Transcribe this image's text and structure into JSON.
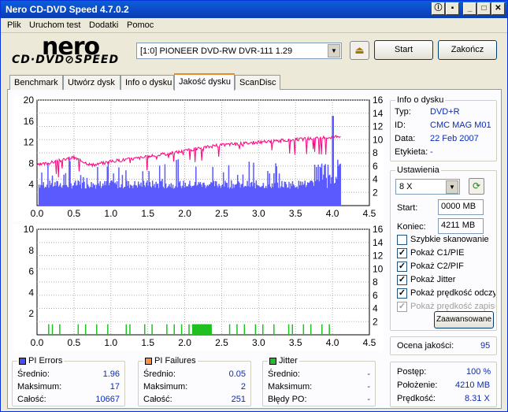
{
  "window": {
    "title": "Nero CD-DVD Speed 4.7.0.2"
  },
  "menu": [
    "Plik",
    "Uruchom test",
    "Dodatki",
    "Pomoc"
  ],
  "logo": {
    "brand": "nero",
    "subtitle": "CD·DVD⊘SPEED"
  },
  "drive": {
    "selected": "[1:0]   PIONEER DVD-RW  DVR-111 1.29"
  },
  "buttons": {
    "start": "Start",
    "end": "Zakończ",
    "advanced": "Zaawansowane"
  },
  "tabs": [
    "Benchmark",
    "Utwórz dysk",
    "Info o dysku",
    "Jakość dysku",
    "ScanDisc"
  ],
  "active_tab": "Jakość dysku",
  "disc_info": {
    "caption": "Info o dysku",
    "typ_label": "Typ:",
    "typ": "DVD+R",
    "id_label": "ID:",
    "id": "CMC MAG M01",
    "data_label": "Data:",
    "data": "22 Feb 2007",
    "etykieta_label": "Etykieta:",
    "etykieta": "-"
  },
  "settings": {
    "caption": "Ustawienia",
    "speed": "8 X",
    "start_label": "Start:",
    "start": "0000 MB",
    "end_label": "Koniec:",
    "end": "4211 MB",
    "checks": [
      {
        "label": "Szybkie skanowanie",
        "checked": false,
        "enabled": true
      },
      {
        "label": "Pokaż C1/PIE",
        "checked": true,
        "enabled": true
      },
      {
        "label": "Pokaż C2/PIF",
        "checked": true,
        "enabled": true
      },
      {
        "label": "Pokaż Jitter",
        "checked": true,
        "enabled": true
      },
      {
        "label": "Pokaż prędkość odczytu",
        "checked": true,
        "enabled": true
      },
      {
        "label": "Pokaż prędkość zapisu",
        "checked": true,
        "enabled": false
      }
    ]
  },
  "quality": {
    "label": "Ocena jakości:",
    "value": "95"
  },
  "progress": {
    "postep_label": "Postęp:",
    "postep": "100 %",
    "polozenie_label": "Położenie:",
    "polozenie": "4210 MB",
    "predkosc_label": "Prędkość:",
    "predkosc": "8.31 X"
  },
  "pi_errors": {
    "caption": "PI Errors",
    "color": "#4a4aff",
    "avg_label": "Średnio:",
    "avg": "1.96",
    "max_label": "Maksimum:",
    "max": "17",
    "total_label": "Całość:",
    "total": "10667"
  },
  "pi_failures": {
    "caption": "PI Failures",
    "color": "#ff9040",
    "avg_label": "Średnio:",
    "avg": "0.05",
    "max_label": "Maksimum:",
    "max": "2",
    "total_label": "Całość:",
    "total": "251"
  },
  "jitter": {
    "caption": "Jitter",
    "color": "#20c020",
    "avg_label": "Średnio:",
    "avg": "-",
    "max_label": "Maksimum:",
    "max": "-",
    "po_label": "Błędy PO:",
    "po": "-"
  },
  "chart_data": [
    {
      "type": "bar",
      "name": "PI Errors with read speed",
      "x_unit": "GB",
      "xlim": [
        0,
        4.5
      ],
      "ylim_left": [
        0,
        20
      ],
      "ylim_right": [
        0,
        16
      ],
      "x_ticks": [
        "0.0",
        "0.5",
        "1.0",
        "1.5",
        "2.0",
        "2.5",
        "3.0",
        "3.5",
        "4.0",
        "4.5"
      ],
      "left_ticks": [
        "20",
        "16",
        "12",
        "8",
        "4"
      ],
      "right_ticks": [
        "16",
        "14",
        "12",
        "10",
        "8",
        "6",
        "4",
        "2"
      ],
      "pie_baseline": 4,
      "pie_max": 17,
      "pie_max_at": 4.0,
      "data_end": 4.11,
      "speed_curve": {
        "x": [
          0,
          0.3,
          0.5,
          0.75,
          1.0,
          1.5,
          2.0,
          2.3,
          2.6,
          3.0,
          3.5,
          4.0,
          4.1
        ],
        "y": [
          6.1,
          6.8,
          7.3,
          6.1,
          6.7,
          7.4,
          8.3,
          8.9,
          9.3,
          9.6,
          10.0,
          10.4,
          10.6
        ]
      }
    },
    {
      "type": "bar",
      "name": "PI Failures",
      "x_unit": "GB",
      "xlim": [
        0,
        4.5
      ],
      "ylim_left": [
        0,
        10
      ],
      "ylim_right": [
        0,
        16
      ],
      "x_ticks": [
        "0.0",
        "0.5",
        "1.0",
        "1.5",
        "2.0",
        "2.5",
        "3.0",
        "3.5",
        "4.0",
        "4.5"
      ],
      "left_ticks": [
        "10",
        "8",
        "6",
        "4",
        "2"
      ],
      "right_ticks": [
        "16",
        "14",
        "12",
        "10",
        "8",
        "6",
        "4",
        "2"
      ],
      "pif_spikes_x": [
        0.15,
        0.2,
        0.3,
        0.55,
        0.65,
        0.8,
        0.95,
        1.2,
        1.25,
        1.45,
        1.55,
        1.75,
        1.85,
        1.95,
        2.05,
        2.1,
        2.15,
        2.18,
        2.22,
        2.26,
        2.3,
        2.35,
        2.6,
        2.7,
        2.8,
        2.95,
        3.05,
        3.2,
        3.4,
        3.45,
        3.6,
        3.7,
        3.85,
        3.95
      ],
      "pif_value": 1
    }
  ]
}
